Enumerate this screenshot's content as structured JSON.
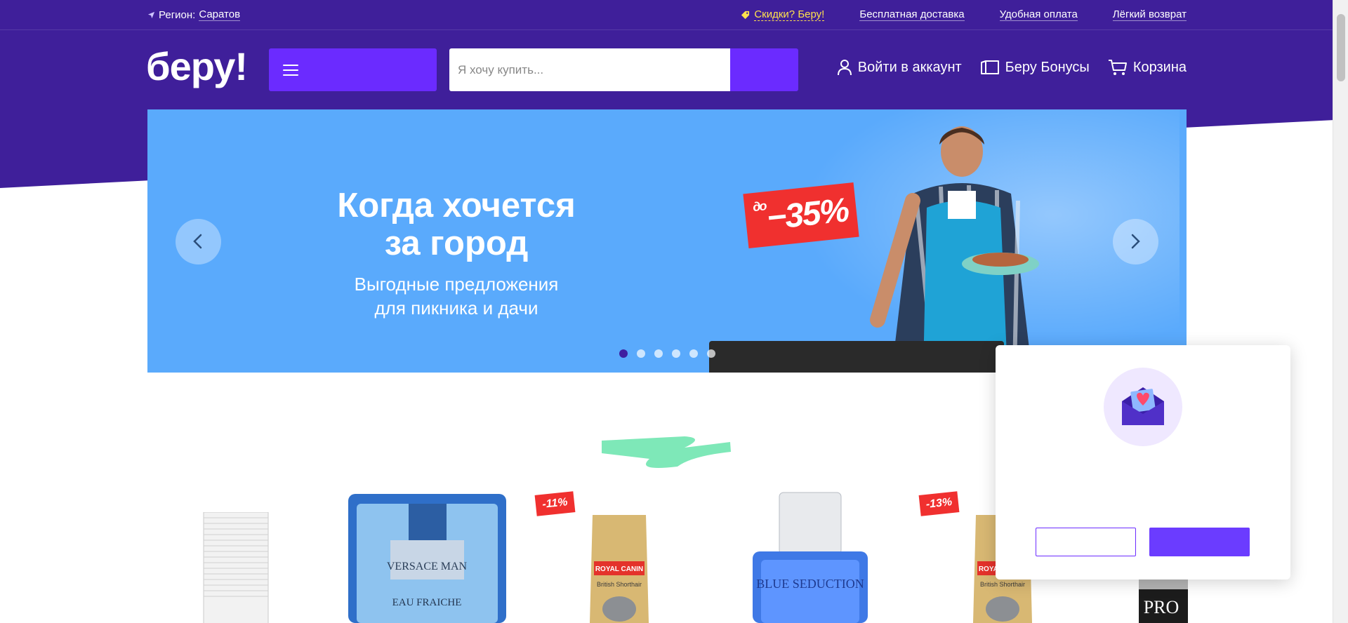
{
  "colors": {
    "brand_purple": "#3f1f9a",
    "accent_purple": "#6b2bff",
    "banner_blue": "#5aaafc",
    "promo_yellow": "#ffe14d",
    "discount_red": "#f0302f",
    "mint": "#7ee8b8"
  },
  "topbar": {
    "region_label": "Регион:",
    "region_city": "Саратов",
    "promo_link": "Скидки? Беру!",
    "links": [
      "Бесплатная доставка",
      "Удобная оплата",
      "Лёгкий возврат"
    ]
  },
  "header": {
    "logo": "беру!",
    "search_placeholder": "Я хочу купить...",
    "login": "Войти в аккаунт",
    "bonuses": "Беру Бонусы",
    "cart": "Корзина"
  },
  "banner": {
    "title_line1": "Когда хочется",
    "title_line2": "за город",
    "subtitle_line1": "Выгодные предложения",
    "subtitle_line2": "для пикника и дачи",
    "discount_prefix": "до",
    "discount_value": "−35%",
    "slides_total": 6,
    "active_slide": 1
  },
  "products": {
    "badges": [
      "-11%",
      "-13%"
    ],
    "items": [
      {
        "kind": "blinds",
        "label": ""
      },
      {
        "kind": "perfume",
        "label": "VERSACE MAN",
        "sub": "EAU FRAICHE"
      },
      {
        "kind": "cat-food",
        "label": "ROYAL CANIN",
        "sub": "British Shorthair"
      },
      {
        "kind": "perfume-blue",
        "label": "BLUE SEDUCTION"
      },
      {
        "kind": "cat-food",
        "label": "ROYAL CANIN",
        "sub": "British Shorthair"
      },
      {
        "kind": "pet-food",
        "label": "PRO"
      }
    ]
  }
}
